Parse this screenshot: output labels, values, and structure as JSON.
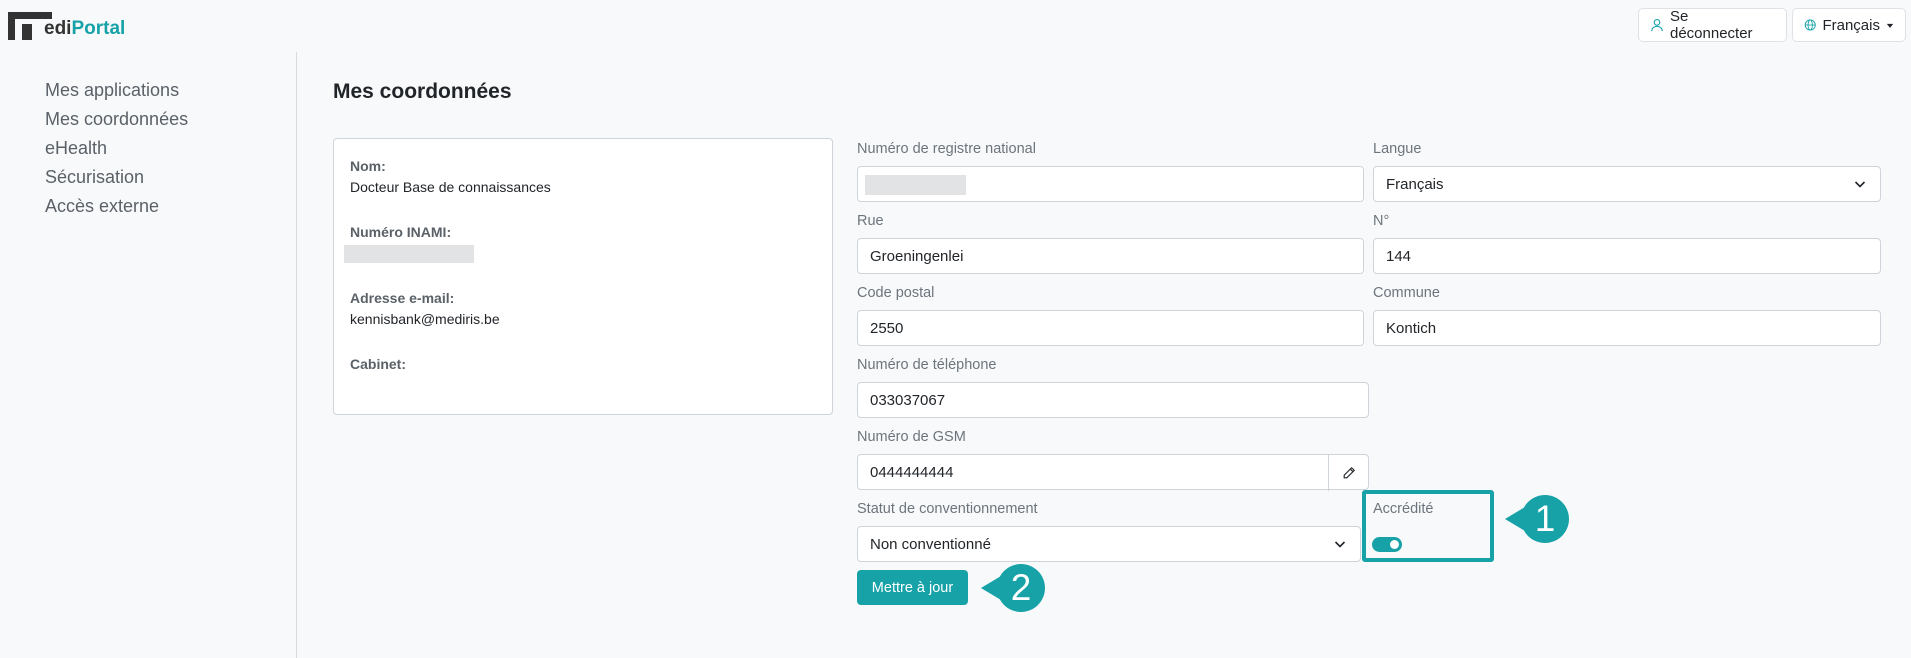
{
  "header": {
    "logo_initial": "m",
    "logo_left": "edi",
    "logo_right": "Portal",
    "logout_label": "Se déconnecter",
    "language_label": "Français"
  },
  "sidebar": {
    "items": [
      {
        "label": "Mes applications"
      },
      {
        "label": "Mes coordonnées"
      },
      {
        "label": "eHealth"
      },
      {
        "label": "Sécurisation"
      },
      {
        "label": "Accès externe"
      }
    ]
  },
  "main": {
    "title": "Mes coordonnées",
    "info": {
      "name_label": "Nom:",
      "name_value": "Docteur Base de connaissances",
      "inami_label": "Numéro INAMI:",
      "email_label": "Adresse e-mail:",
      "email_value": "kennisbank@mediris.be",
      "cabinet_label": "Cabinet:"
    },
    "form": {
      "rrn_label": "Numéro de registre national",
      "langue_label": "Langue",
      "langue_value": "Français",
      "rue_label": "Rue",
      "rue_value": "Groeningenlei",
      "num_label": "N°",
      "num_value": "144",
      "cp_label": "Code postal",
      "cp_value": "2550",
      "commune_label": "Commune",
      "commune_value": "Kontich",
      "tel_label": "Numéro de téléphone",
      "tel_value": "033037067",
      "gsm_label": "Numéro de GSM",
      "gsm_value": "0444444444",
      "statut_label": "Statut de conventionnement",
      "statut_value": "Non conventionné",
      "accredite_label": "Accrédité",
      "accredite_on": true,
      "submit_label": "Mettre à jour"
    },
    "callouts": {
      "first": "1",
      "second": "2"
    }
  },
  "colors": {
    "accent": "#17a2a8",
    "background": "#f8f9fa"
  },
  "icons": [
    "user-icon",
    "globe-icon",
    "caret-down-icon",
    "chevron-down-icon",
    "pencil-icon"
  ]
}
